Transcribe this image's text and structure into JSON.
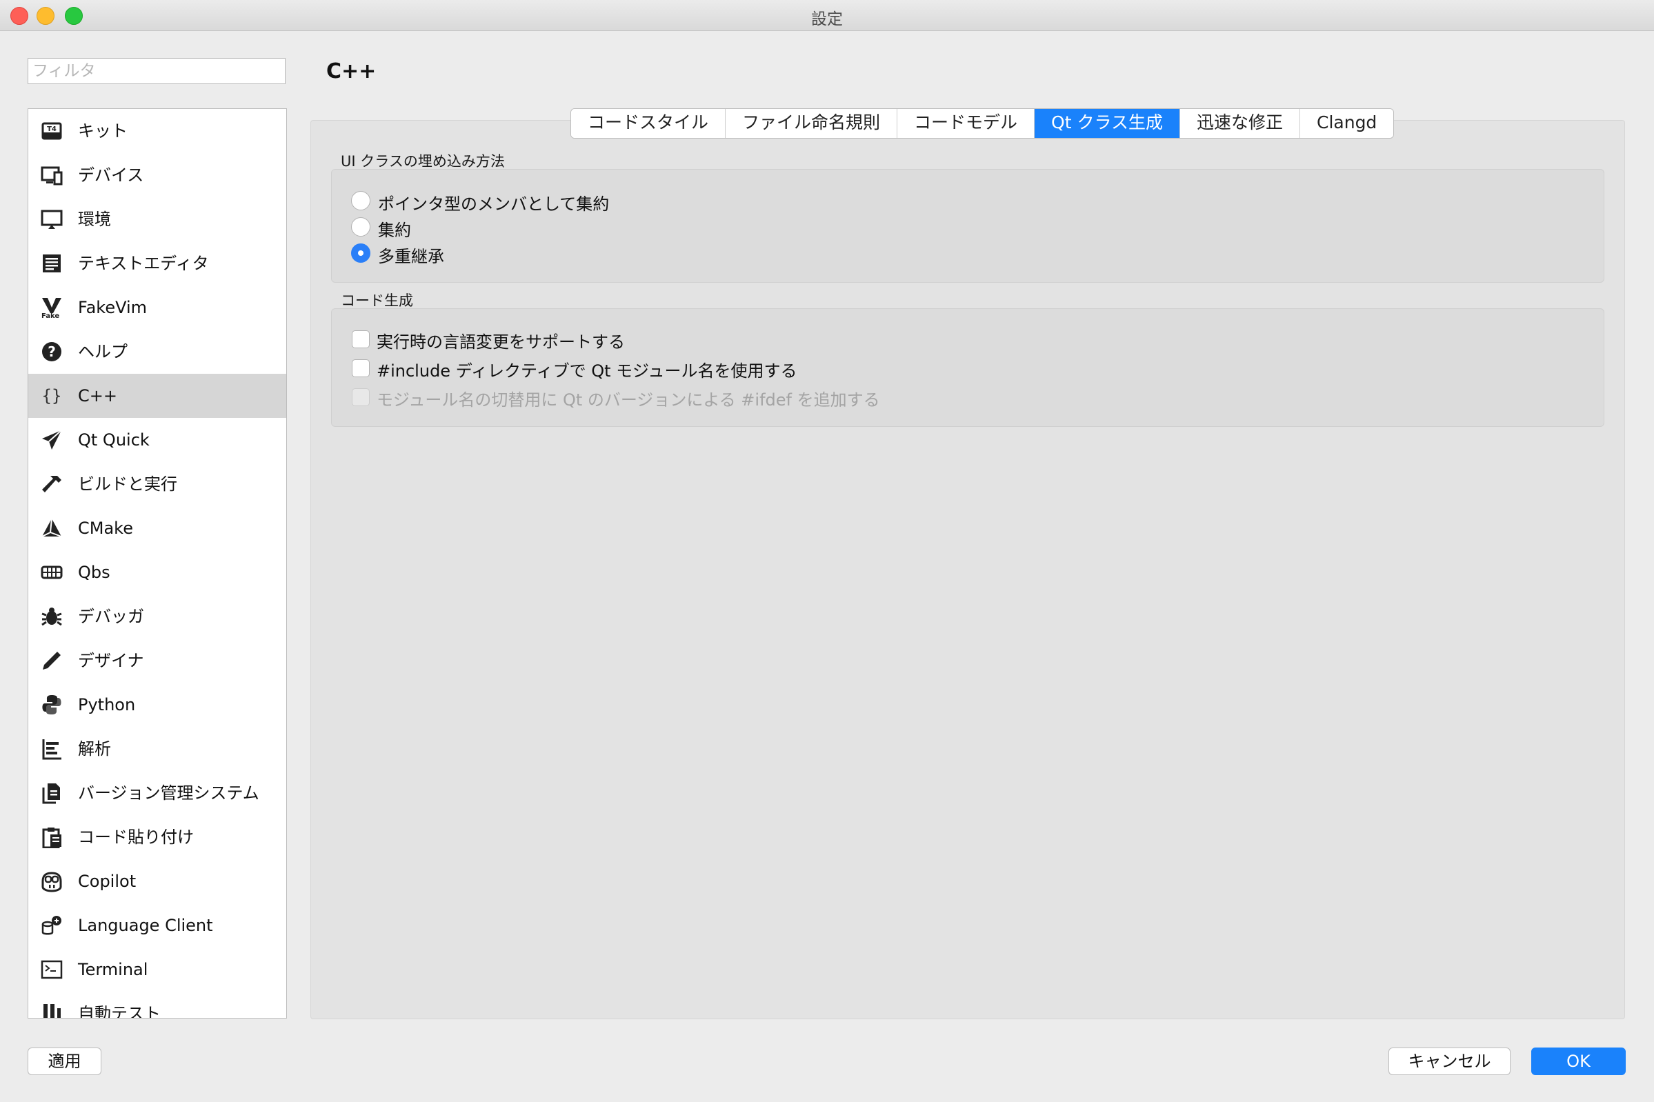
{
  "window": {
    "title": "設定"
  },
  "filter": {
    "placeholder": "フィルタ"
  },
  "sidebar": {
    "items": [
      {
        "label": "キット",
        "icon": "kit-icon"
      },
      {
        "label": "デバイス",
        "icon": "device-icon"
      },
      {
        "label": "環境",
        "icon": "monitor-icon"
      },
      {
        "label": "テキストエディタ",
        "icon": "text-editor-icon"
      },
      {
        "label": "FakeVim",
        "icon": "fakevim-icon"
      },
      {
        "label": "ヘルプ",
        "icon": "help-icon"
      },
      {
        "label": "C++",
        "icon": "braces-icon",
        "selected": true
      },
      {
        "label": "Qt Quick",
        "icon": "paper-plane-icon"
      },
      {
        "label": "ビルドと実行",
        "icon": "hammer-icon"
      },
      {
        "label": "CMake",
        "icon": "cmake-icon"
      },
      {
        "label": "Qbs",
        "icon": "qbs-icon"
      },
      {
        "label": "デバッガ",
        "icon": "bug-icon"
      },
      {
        "label": "デザイナ",
        "icon": "pencil-icon"
      },
      {
        "label": "Python",
        "icon": "python-icon"
      },
      {
        "label": "解析",
        "icon": "analyze-icon"
      },
      {
        "label": "バージョン管理システム",
        "icon": "version-control-icon"
      },
      {
        "label": "コード貼り付け",
        "icon": "clipboard-icon"
      },
      {
        "label": "Copilot",
        "icon": "copilot-icon"
      },
      {
        "label": "Language Client",
        "icon": "language-client-icon"
      },
      {
        "label": "Terminal",
        "icon": "terminal-icon"
      },
      {
        "label": "自動テスト",
        "icon": "flask-icon"
      }
    ]
  },
  "page": {
    "title": "C++"
  },
  "tabs": [
    {
      "label": "コードスタイル"
    },
    {
      "label": "ファイル命名規則"
    },
    {
      "label": "コードモデル"
    },
    {
      "label": "Qt クラス生成",
      "active": true
    },
    {
      "label": "迅速な修正"
    },
    {
      "label": "Clangd"
    }
  ],
  "embedding": {
    "label": "UI クラスの埋め込み方法",
    "options": [
      {
        "label": "ポインタ型のメンバとして集約",
        "checked": false
      },
      {
        "label": "集約",
        "checked": false
      },
      {
        "label": "多重継承",
        "checked": true
      }
    ]
  },
  "codegen": {
    "label": "コード生成",
    "options": [
      {
        "label": "実行時の言語変更をサポートする",
        "checked": false,
        "enabled": true
      },
      {
        "label": "#include ディレクティブで Qt モジュール名を使用する",
        "checked": false,
        "enabled": true
      },
      {
        "label": "モジュール名の切替用に Qt のバージョンによる #ifdef を追加する",
        "checked": false,
        "enabled": false
      }
    ]
  },
  "buttons": {
    "apply": "適用",
    "cancel": "キャンセル",
    "ok": "OK"
  },
  "colors": {
    "accent": "#1a82fb",
    "selection": "#d6d6d6"
  }
}
